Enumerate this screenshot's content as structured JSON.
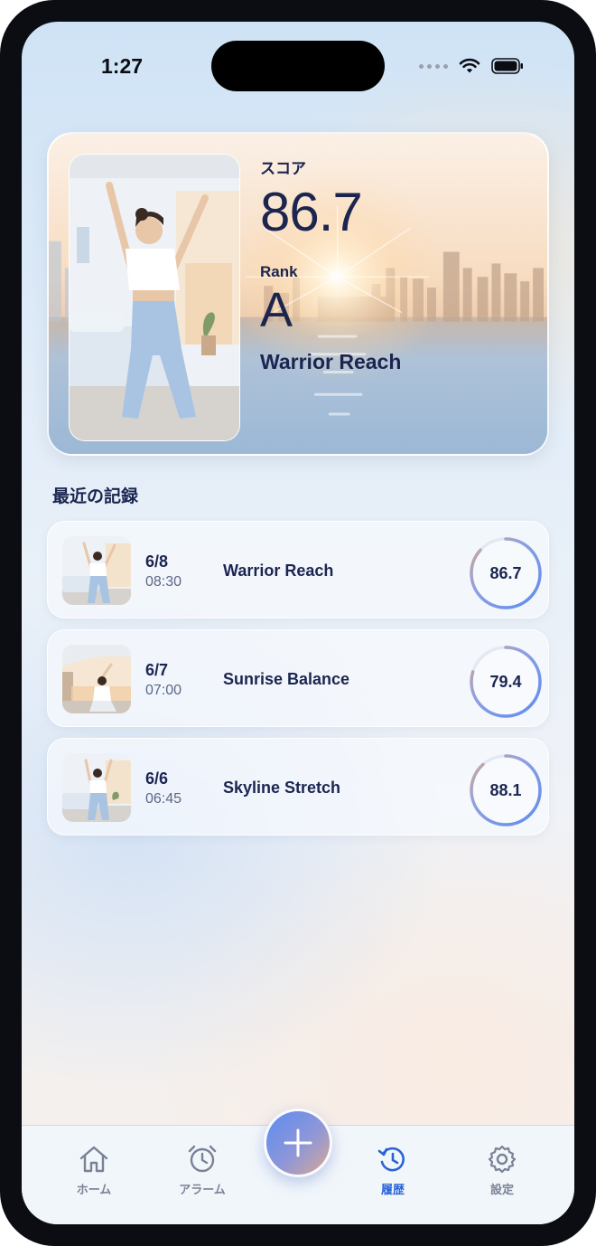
{
  "status_bar": {
    "time": "1:27"
  },
  "hero": {
    "score_label": "スコア",
    "score_value": "86.7",
    "rank_label": "Rank",
    "rank_value": "A",
    "exercise_name": "Warrior Reach"
  },
  "recent": {
    "title": "最近の記録",
    "records": [
      {
        "date": "6/8",
        "time": "08:30",
        "name": "Warrior Reach",
        "score": "86.7"
      },
      {
        "date": "6/7",
        "time": "07:00",
        "name": "Sunrise Balance",
        "score": "79.4"
      },
      {
        "date": "6/6",
        "time": "06:45",
        "name": "Skyline Stretch",
        "score": "88.1"
      }
    ]
  },
  "tabbar": {
    "home_label": "ホーム",
    "alarm_label": "アラーム",
    "history_label": "履歴",
    "settings_label": "設定",
    "active": "history"
  },
  "colors": {
    "text_primary": "#1b2550",
    "accent": "#2a63d8",
    "ring_start": "#5b8df0",
    "ring_end": "#d7a992"
  }
}
